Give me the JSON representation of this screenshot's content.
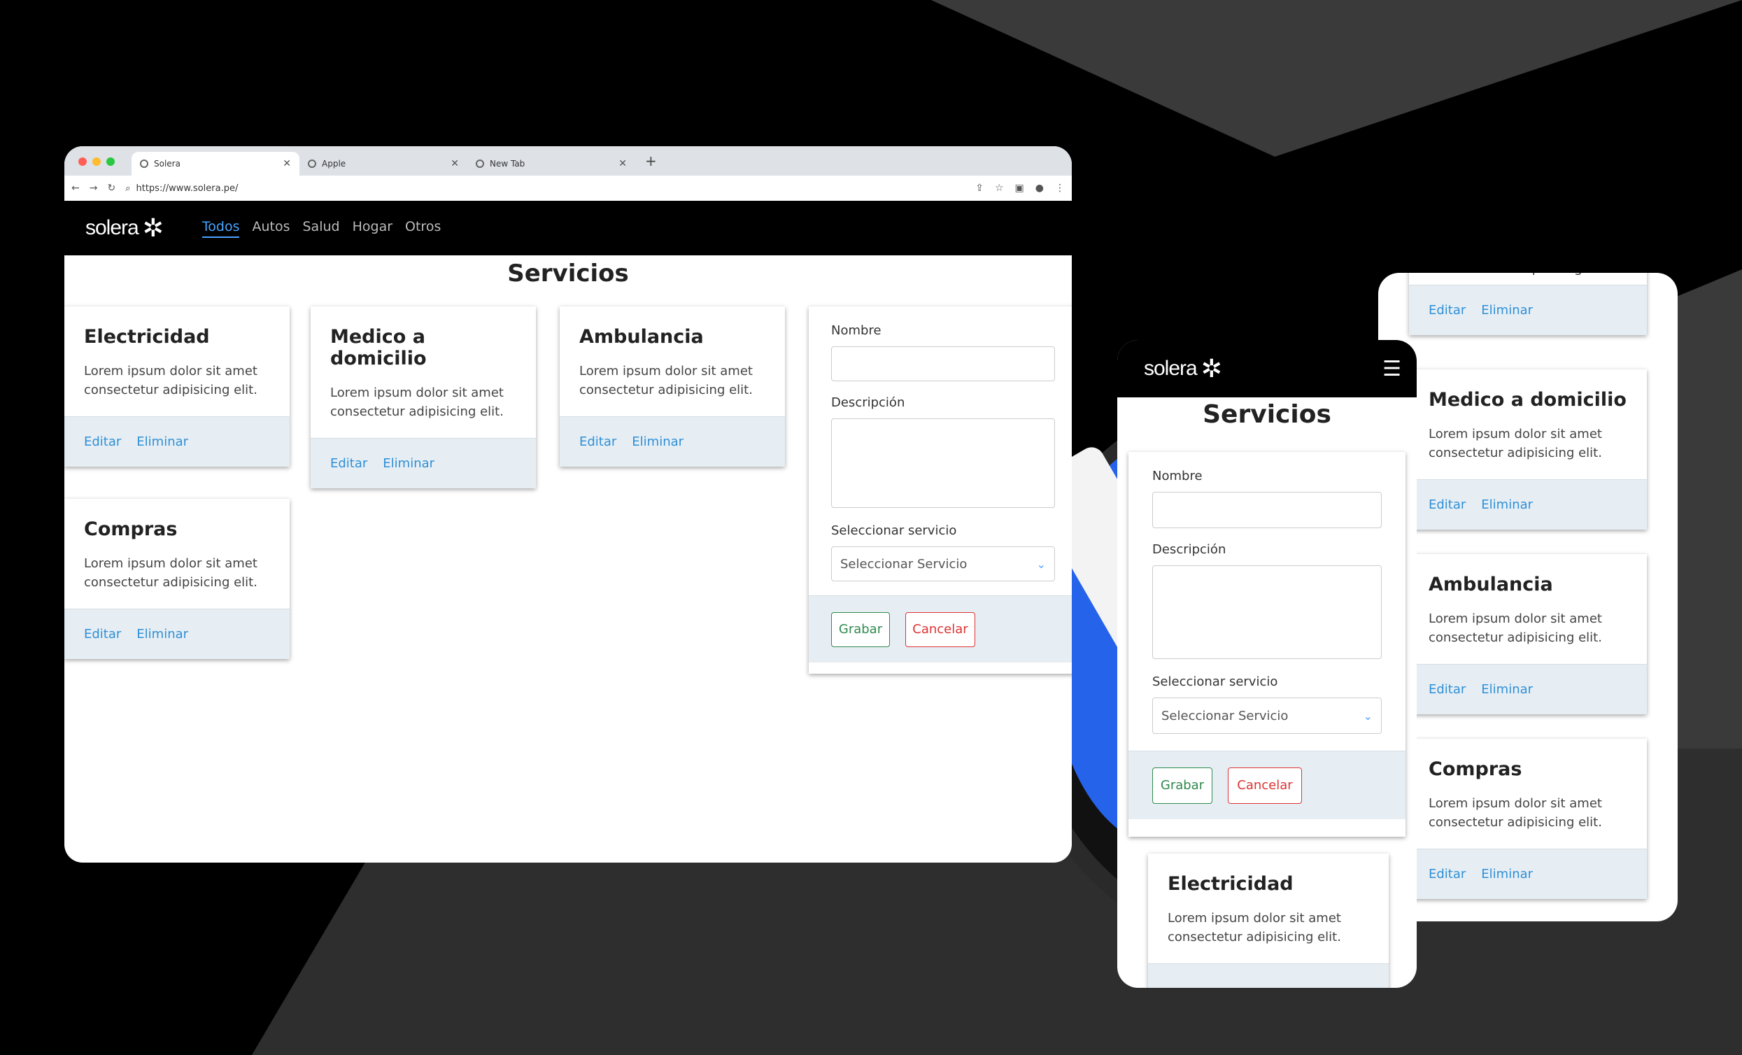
{
  "browser": {
    "tabs": [
      {
        "label": "Solera"
      },
      {
        "label": "Apple"
      },
      {
        "label": "New Tab"
      }
    ],
    "url": "https://www.solera.pe/"
  },
  "brand": {
    "name": "solera"
  },
  "nav": {
    "links": [
      "Todos",
      "Autos",
      "Salud",
      "Hogar",
      "Otros"
    ],
    "active": "Todos"
  },
  "page": {
    "title": "Servicios"
  },
  "services": [
    {
      "title": "Electricidad",
      "description": "Lorem ipsum dolor sit amet consectetur adipisicing elit.",
      "edit": "Editar",
      "delete": "Eliminar"
    },
    {
      "title": "Medico a domicilio",
      "description": "Lorem ipsum dolor sit amet consectetur adipisicing elit.",
      "edit": "Editar",
      "delete": "Eliminar"
    },
    {
      "title": "Ambulancia",
      "description": "Lorem ipsum dolor sit amet consectetur adipisicing elit.",
      "edit": "Editar",
      "delete": "Eliminar"
    },
    {
      "title": "Compras",
      "description": "Lorem ipsum dolor sit amet consectetur adipisicing elit.",
      "edit": "Editar",
      "delete": "Eliminar"
    }
  ],
  "form": {
    "name_label": "Nombre",
    "name_value": "",
    "description_label": "Descripción",
    "description_value": "",
    "select_label": "Seleccionar servicio",
    "select_value": "Seleccionar Servicio",
    "save": "Grabar",
    "cancel": "Cancelar"
  },
  "tablet": {
    "partial_description": "consectetur adipisicing elit."
  },
  "colors": {
    "link": "#2f8fd6",
    "nav_active": "#4aa3ff",
    "footer_bg": "#e6eef4",
    "save": "#2f8a4e",
    "cancel": "#dd3333"
  }
}
